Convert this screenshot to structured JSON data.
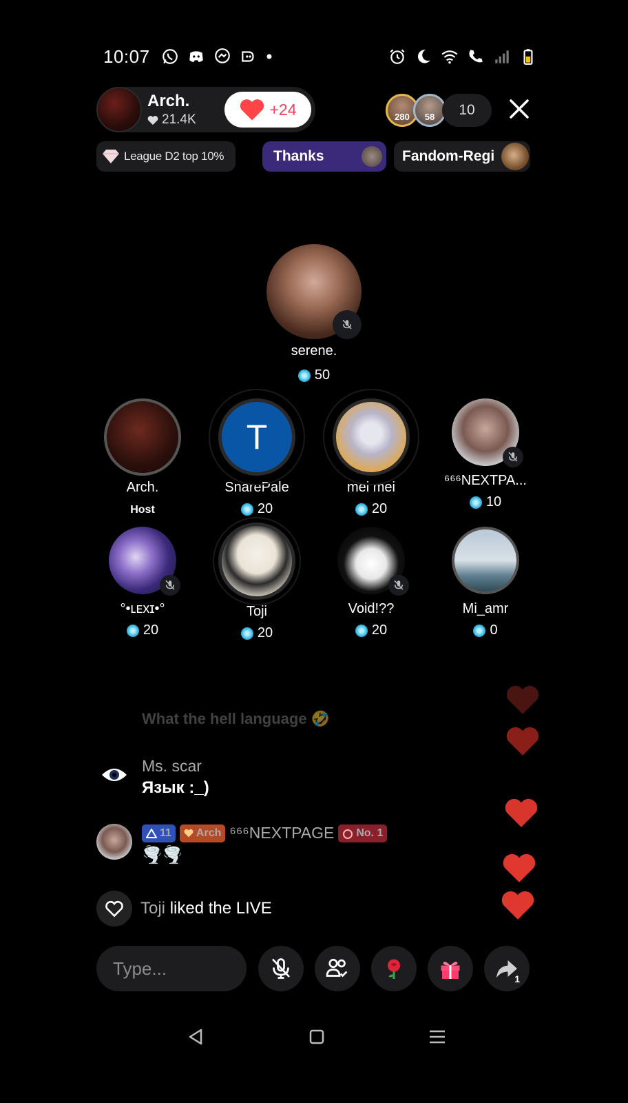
{
  "status_bar": {
    "time": "10:07",
    "left_icons": [
      "whatsapp-icon",
      "discord-icon",
      "messenger-icon",
      "app-icon",
      "more-dot-icon"
    ],
    "right_icons": [
      "alarm-icon",
      "moon-icon",
      "wifi-icon",
      "wifi-call-icon",
      "signal-icon",
      "battery-icon"
    ]
  },
  "host": {
    "name": "Arch.",
    "likes": "21.4K",
    "like_button_label": "+24"
  },
  "viewers": {
    "avatar_1_badge": "280",
    "avatar_2_badge": "58",
    "count": "10"
  },
  "pills": {
    "league": "League D2 top 10%",
    "thanks": "Thanks",
    "fandom": "Fandom-Regi"
  },
  "featured_seat": {
    "name": "serene.",
    "coins": "50"
  },
  "seats_row1": [
    {
      "name": "Arch.",
      "sub": "Host"
    },
    {
      "name": "SnarePale",
      "coins": "20",
      "initial": "T"
    },
    {
      "name": "mei mei",
      "coins": "20"
    },
    {
      "name": "⁶⁶⁶NEXTPA...",
      "coins": "10"
    }
  ],
  "seats_row2": [
    {
      "name": "°•ʟᴇxɪ•°",
      "coins": "20"
    },
    {
      "name": "Toji",
      "coins": "20"
    },
    {
      "name": "Void!??",
      "coins": "20"
    },
    {
      "name": "Mi_amr",
      "coins": "0"
    }
  ],
  "chat": {
    "faded_message": "What the hell language 🤣",
    "messages": [
      {
        "user": "Ms. scar",
        "text": "Язык :_)"
      },
      {
        "level_badge": "11",
        "fan_badge": "Arch",
        "user": "⁶⁶⁶NEXTPAGE",
        "rank_badge": "No. 1",
        "text": "🌪️🌪️"
      }
    ],
    "liked_user": "Toji",
    "liked_text": "liked the LIVE"
  },
  "bottom_bar": {
    "input_placeholder": "Type...",
    "share_count": "1"
  },
  "colors": {
    "background": "#000000",
    "pill_bg": "#1d1d1f",
    "like_red": "#ff3b5c",
    "thanks_purple": "#3b2a7a",
    "heart_red": "#e0382f",
    "coin_blue": "#37b7e2"
  }
}
